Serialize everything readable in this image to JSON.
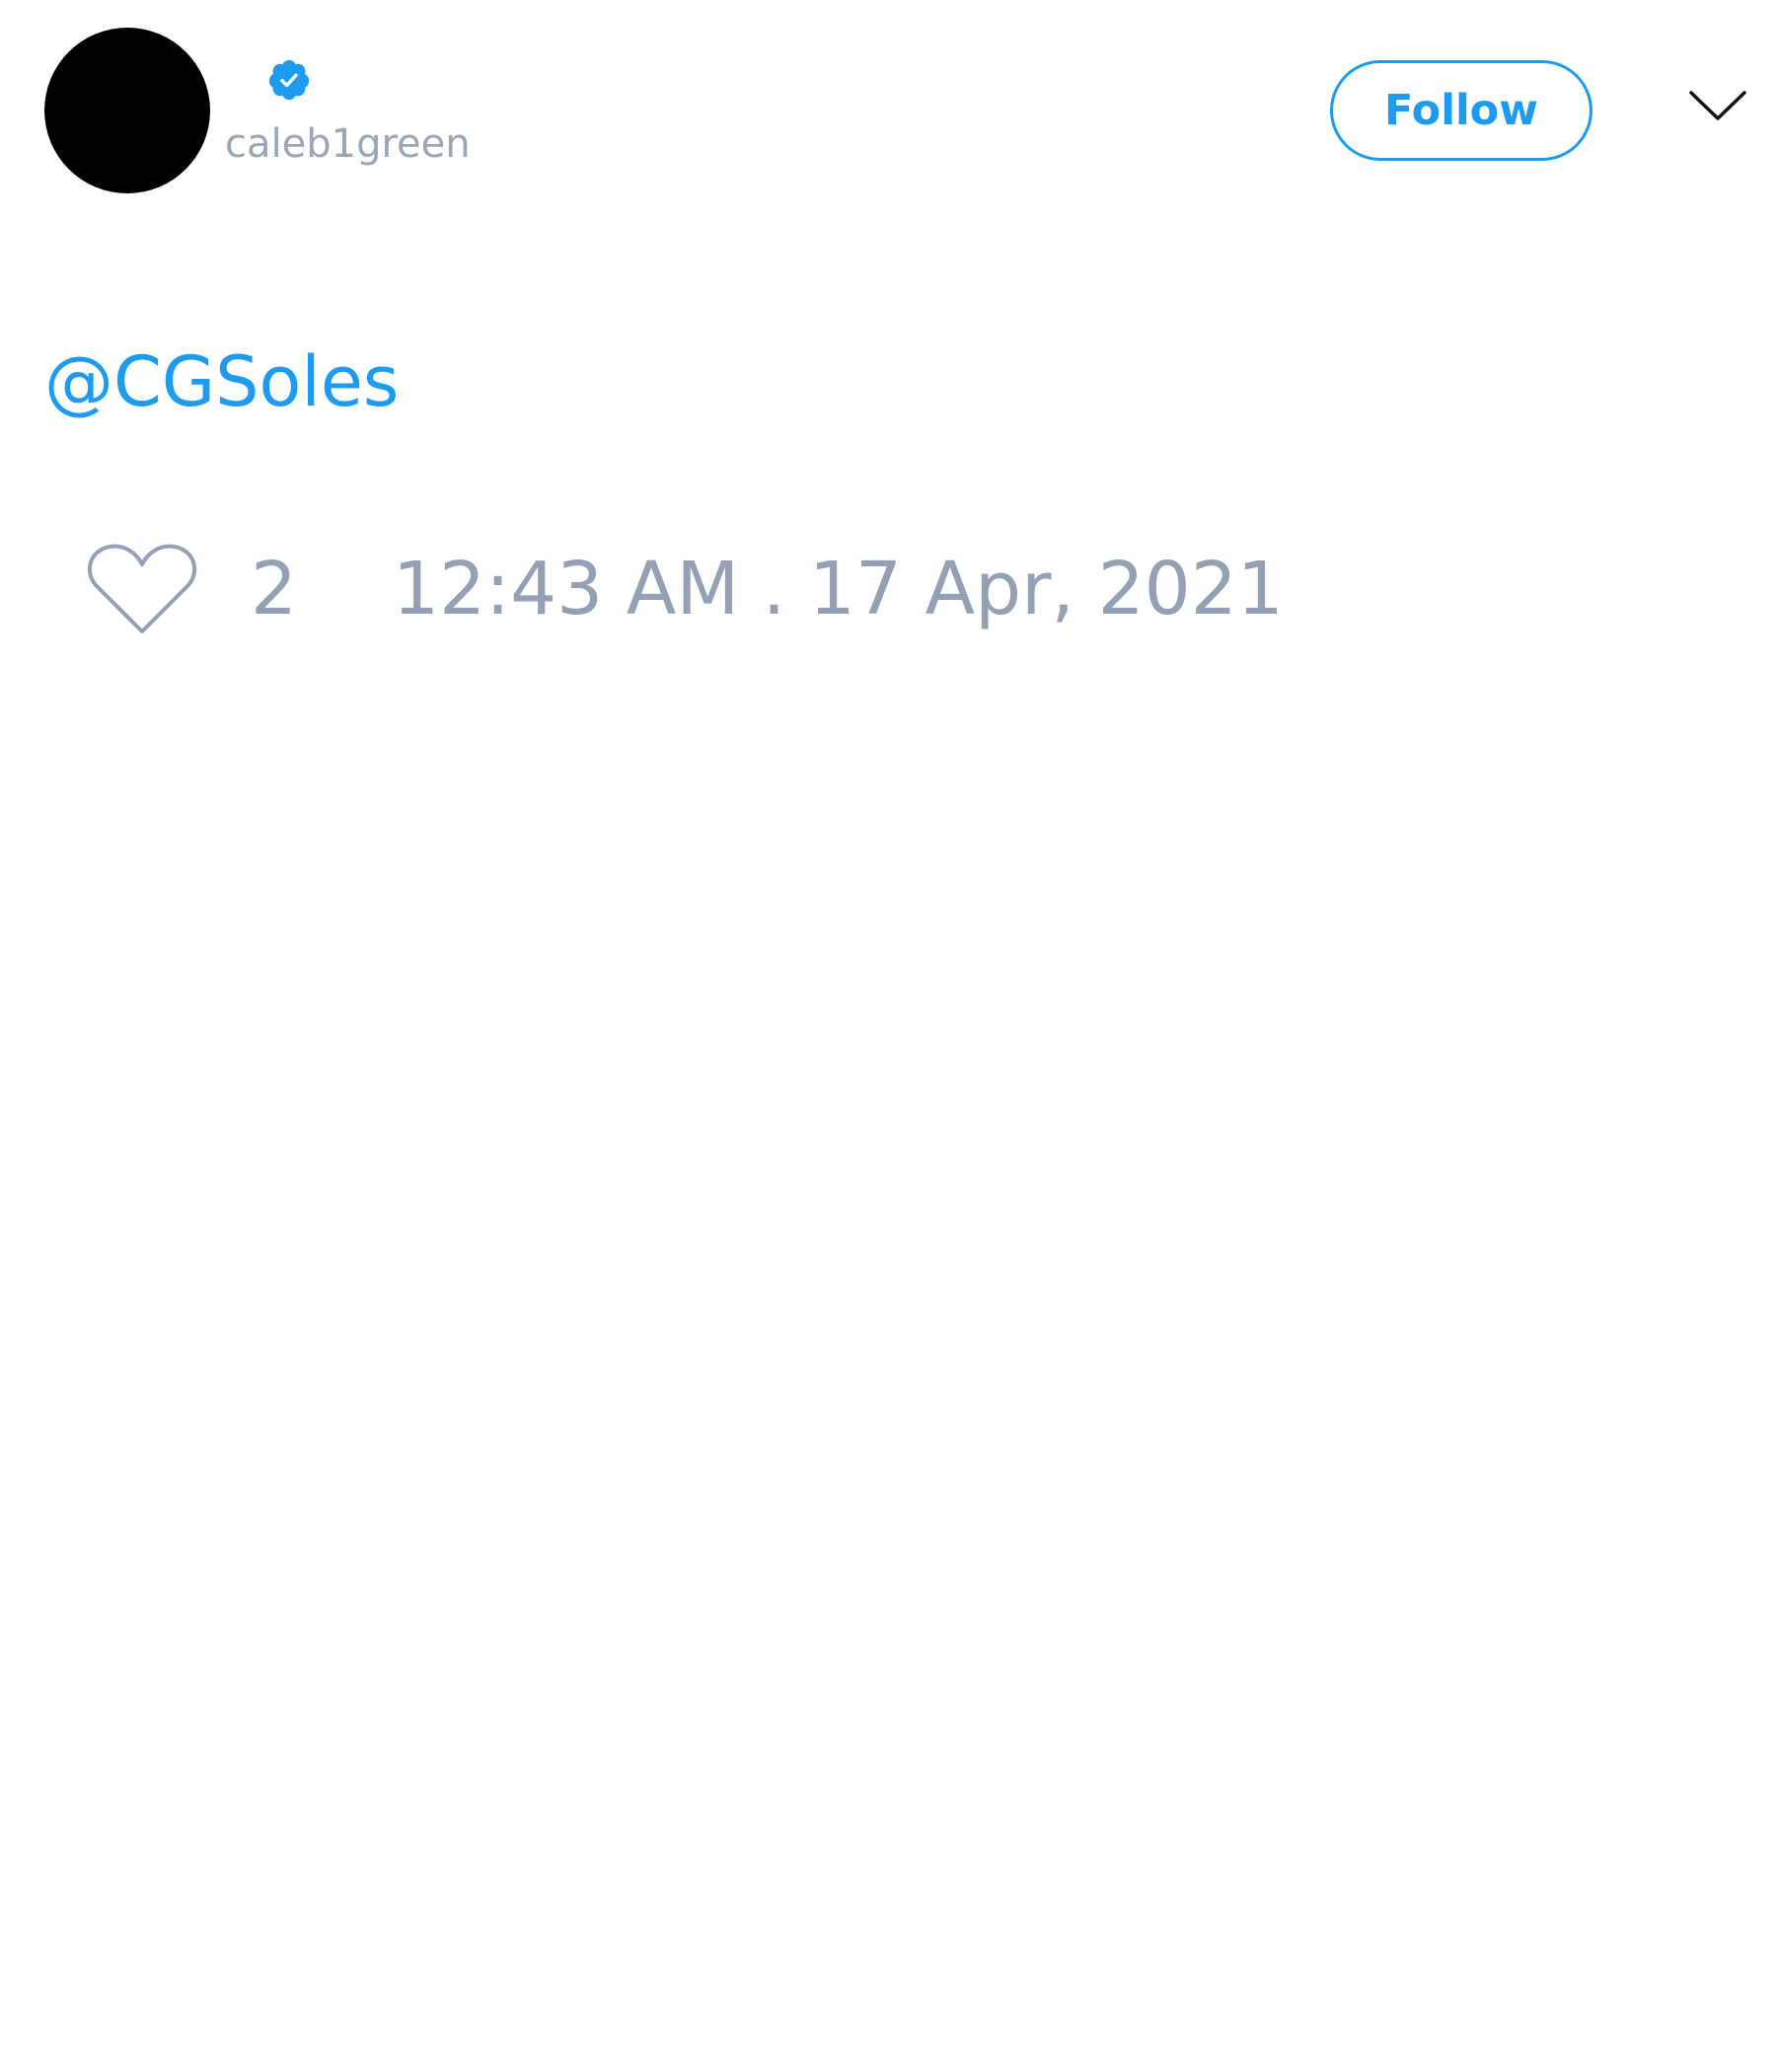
{
  "user": {
    "avatar_color": "#000000",
    "verified": true,
    "handle": "caleb1green"
  },
  "header": {
    "follow_label": "Follow",
    "menu_icon": "chevron-down-icon"
  },
  "tweet": {
    "text": "@CGSoles",
    "like_count": "2",
    "timestamp": "12:43 AM . 17 Apr, 2021"
  },
  "colors": {
    "accent": "#1d9bf0",
    "muted": "#94a1b5",
    "background": "#ffffff"
  }
}
